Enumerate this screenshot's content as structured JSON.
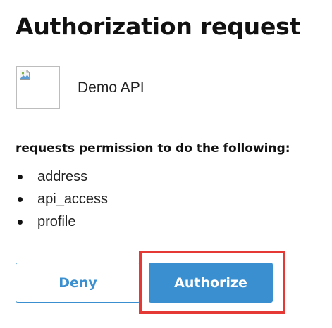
{
  "page": {
    "title": "Authorization request"
  },
  "client": {
    "name": "Demo API",
    "logo_icon": "broken-image-icon"
  },
  "permissions": {
    "heading": "requests permission to do the following:",
    "scopes": [
      "address",
      "api_access",
      "profile"
    ]
  },
  "actions": {
    "deny_label": "Deny",
    "authorize_label": "Authorize"
  },
  "colors": {
    "accent": "#3a8fd0",
    "highlight": "#e53935"
  }
}
